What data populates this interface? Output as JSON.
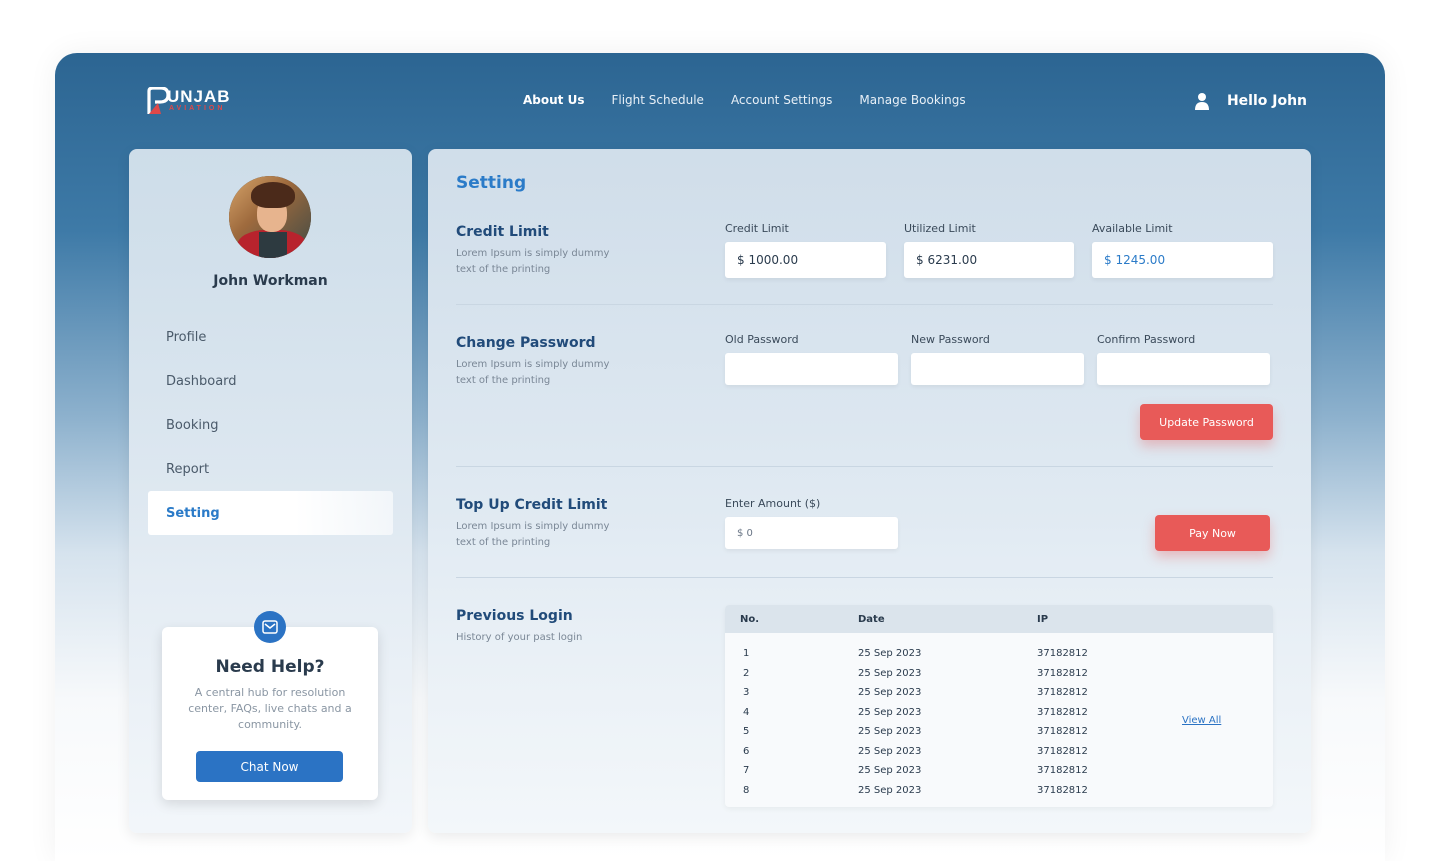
{
  "brand": {
    "word": "UNJAB",
    "sub": "AVIATION",
    "colors": {
      "primary": "#2b73c4",
      "accent": "#e85a58",
      "header": "#2c6592"
    }
  },
  "nav": {
    "items": [
      "About Us",
      "Flight Schedule",
      "Account Settings",
      "Manage Bookings"
    ],
    "active": "About Us"
  },
  "user": {
    "greeting": "Hello John",
    "icon": "user-icon"
  },
  "sidebar": {
    "name": "John Workman",
    "items": [
      {
        "label": "Profile"
      },
      {
        "label": "Dashboard"
      },
      {
        "label": "Booking"
      },
      {
        "label": "Report"
      },
      {
        "label": "Setting"
      }
    ],
    "active": "Setting",
    "help": {
      "icon": "mail-icon",
      "title": "Need Help?",
      "text": "A central hub for resolution center, FAQs, live chats and a community.",
      "button": "Chat Now"
    }
  },
  "main": {
    "title": "Setting",
    "credit": {
      "title": "Credit Limit",
      "desc": "Lorem Ipsum is simply dummy text of the printing",
      "credit_label": "Credit Limit",
      "credit_value": "$ 1000.00",
      "utilized_label": "Utilized Limit",
      "utilized_value": "$ 6231.00",
      "available_label": "Available Limit",
      "available_value": "$ 1245.00"
    },
    "password": {
      "title": "Change Password",
      "desc": "Lorem Ipsum is simply dummy text of the printing",
      "old_label": "Old Password",
      "old_value": "",
      "new_label": "New Password",
      "new_value": "",
      "confirm_label": "Confirm Password",
      "confirm_value": "",
      "button": "Update Password"
    },
    "topup": {
      "title": "Top Up Credit Limit",
      "desc": "Lorem Ipsum is simply dummy text of the printing",
      "amount_label": "Enter Amount ($)",
      "amount_placeholder": "$ 0",
      "button": "Pay Now"
    },
    "logins": {
      "title": "Previous Login",
      "desc": "History of your past login",
      "columns": [
        "No.",
        "Date",
        "IP"
      ],
      "rows": [
        [
          "1",
          "25 Sep 2023",
          "37182812"
        ],
        [
          "2",
          "25 Sep 2023",
          "37182812"
        ],
        [
          "3",
          "25 Sep 2023",
          "37182812"
        ],
        [
          "4",
          "25 Sep 2023",
          "37182812"
        ],
        [
          "5",
          "25 Sep 2023",
          "37182812"
        ],
        [
          "6",
          "25 Sep 2023",
          "37182812"
        ],
        [
          "7",
          "25 Sep 2023",
          "37182812"
        ],
        [
          "8",
          "25 Sep 2023",
          "37182812"
        ]
      ],
      "view_all": "View All"
    }
  }
}
